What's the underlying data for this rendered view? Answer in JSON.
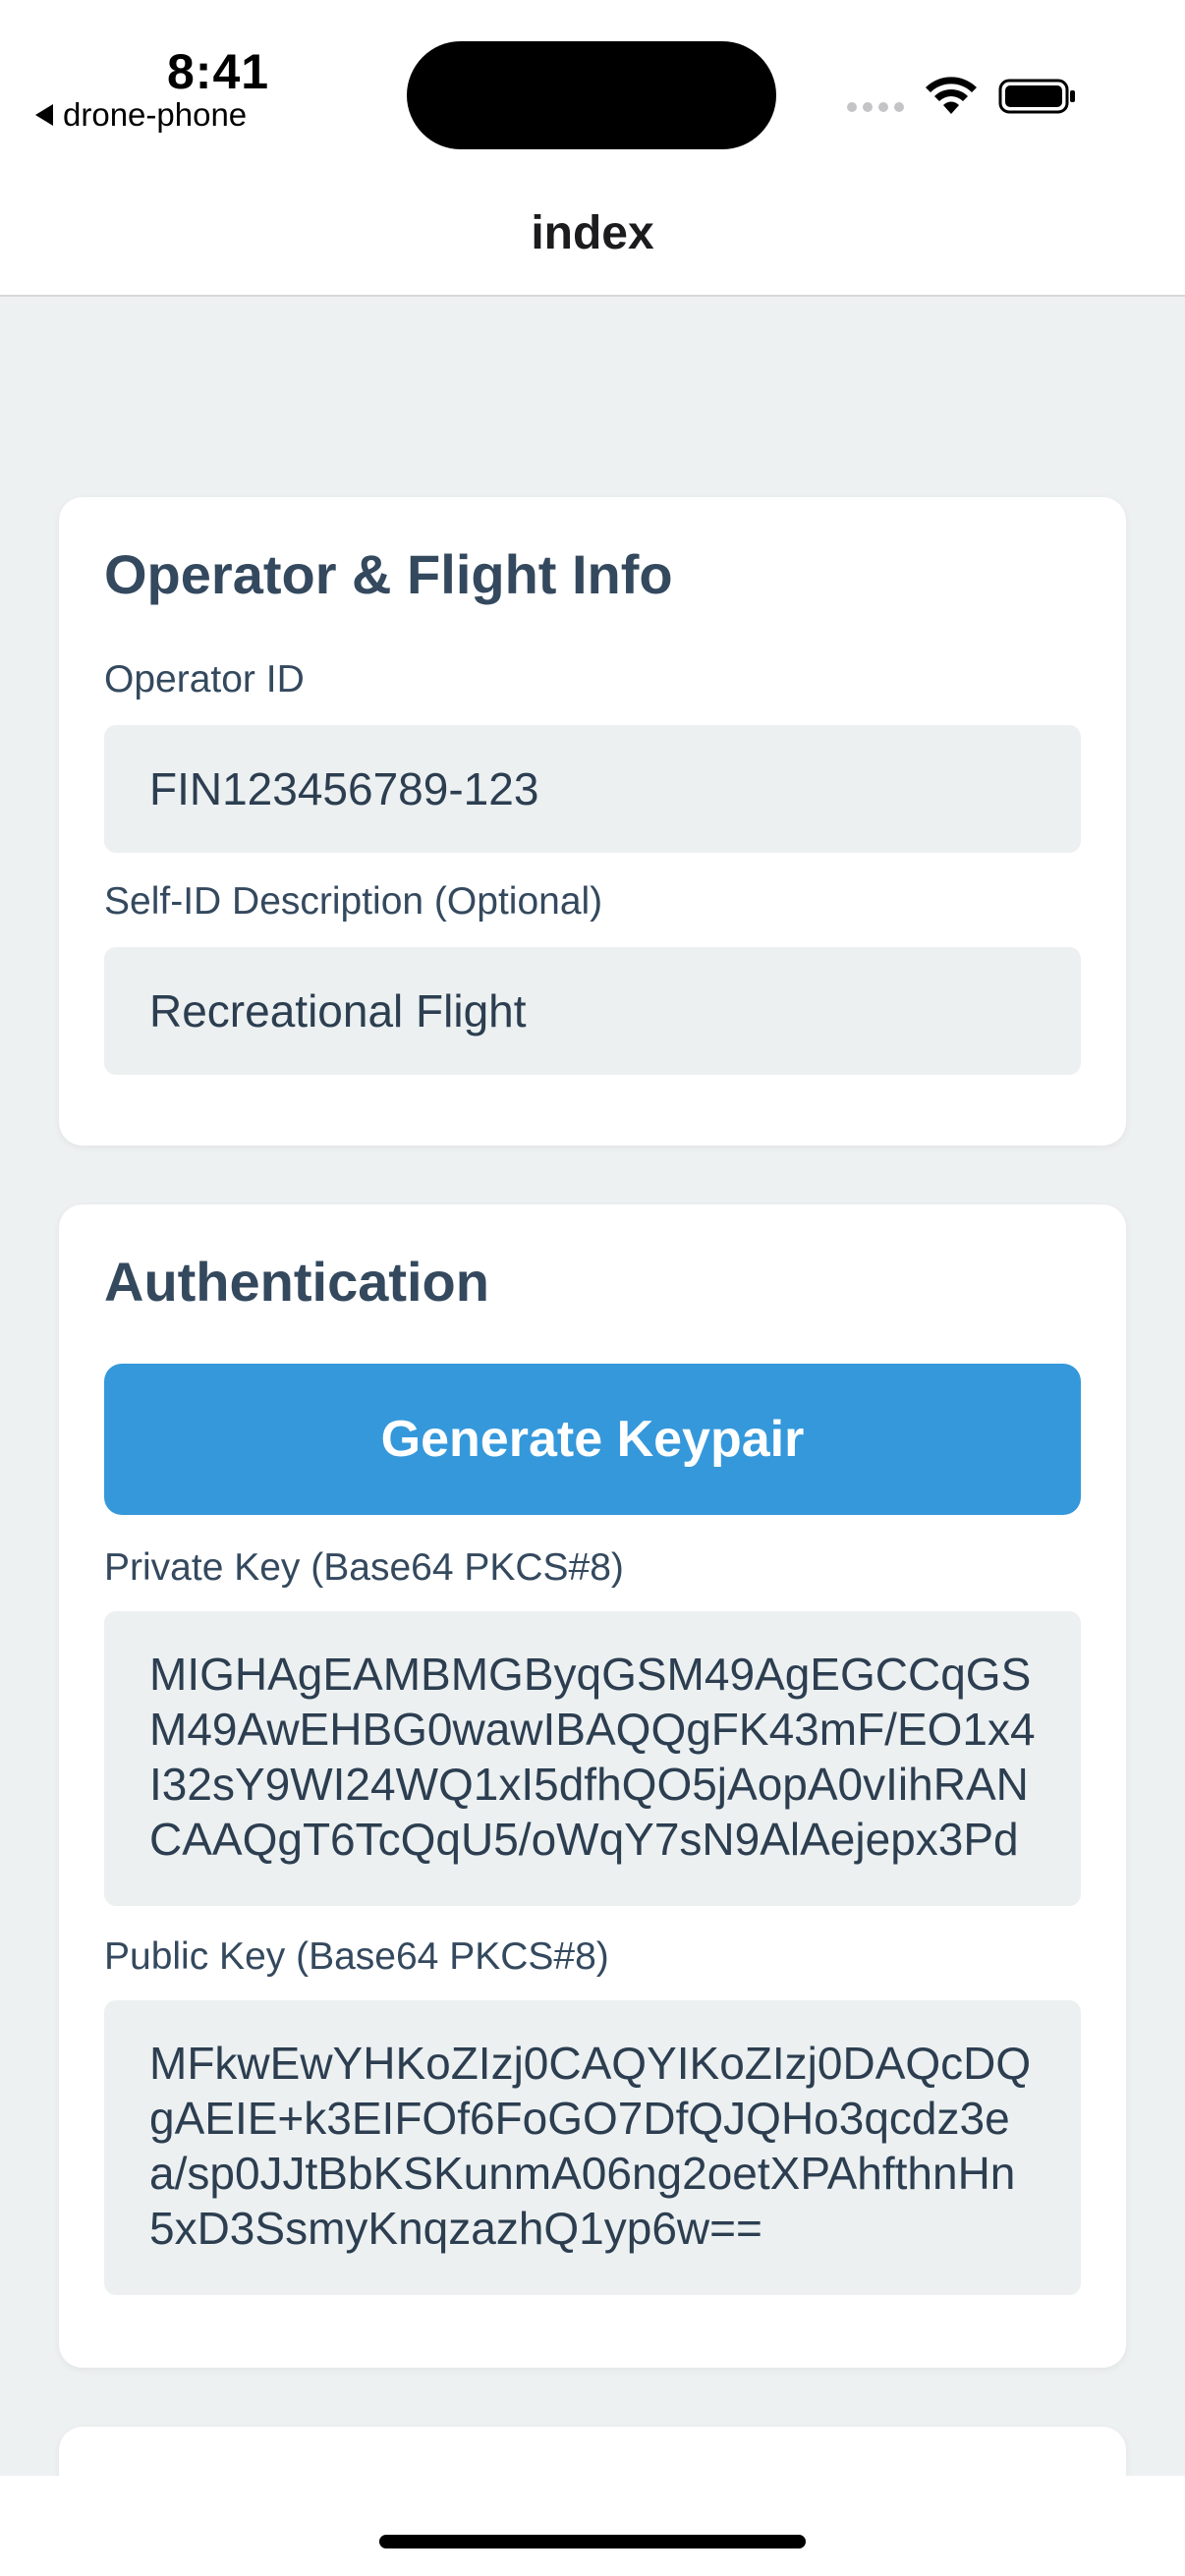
{
  "status_bar": {
    "time": "8:41",
    "back_app": "drone-phone"
  },
  "nav": {
    "title": "index"
  },
  "operator_card": {
    "title": "Operator & Flight Info",
    "operator_id_label": "Operator ID",
    "operator_id_value": "FIN123456789-123",
    "self_id_label": "Self-ID Description (Optional)",
    "self_id_value": "Recreational Flight"
  },
  "auth_card": {
    "title": "Authentication",
    "generate_button": "Generate Keypair",
    "private_key_label": "Private Key (Base64 PKCS#8)",
    "private_key_value": "MIGHAgEAMBMGByqGSM49AgEGCCqGSM49AwEHBG0wawIBAQQgFK43mF/EO1x4I32sY9WI24WQ1xI5dfhQO5jAopA0vIihRANCAAQgT6TcQqU5/oWqY7sN9AlAejepx3Pd",
    "public_key_label": "Public Key (Base64 PKCS#8)",
    "public_key_value": "MFkwEwYHKoZIzj0CAQYIKoZIzj0DAQcDQgAEIE+k3EIFOf6FoGO7DfQJQHo3qcdz3ea/sp0JJtBbKSKunmA06ng2oetXPAhfthnHn5xD3SsmyKnqzazhQ1yp6w=="
  }
}
